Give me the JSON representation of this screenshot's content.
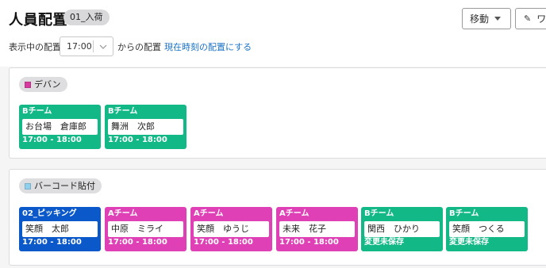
{
  "header": {
    "title": "人員配置",
    "badge": "01_入荷",
    "move_button": "移動",
    "edit_button": "ワ"
  },
  "filter": {
    "label": "表示中の配置:",
    "time": "17:00",
    "suffix": "からの配置",
    "current_link": "現在時刻の配置にする"
  },
  "sections": [
    {
      "name": "デバン",
      "color": "#d63a9f",
      "cards": [
        {
          "team": "Bチーム",
          "name": "お台場　倉庫郎",
          "time": "17:00 - 18:00",
          "color": "#12b886"
        },
        {
          "team": "Bチーム",
          "name": "舞洲　次郎",
          "time": "17:00 - 18:00",
          "color": "#12b886"
        }
      ]
    },
    {
      "name": "バーコード貼付",
      "color": "#8fd0ef",
      "cards": [
        {
          "team": "02_ピッキング",
          "name": "笑顔　太郎",
          "time": "17:00 - 18:00",
          "color": "#0a58ca"
        },
        {
          "team": "Aチーム",
          "name": "中原　ミライ",
          "time": "17:00 - 18:00",
          "color": "#e040b6"
        },
        {
          "team": "Aチーム",
          "name": "笑顔　ゆうじ",
          "time": "17:00 - 18:00",
          "color": "#e040b6"
        },
        {
          "team": "Aチーム",
          "name": "未来　花子",
          "time": "17:00 - 18:00",
          "color": "#e040b6"
        },
        {
          "team": "Bチーム",
          "name": "関西　ひかり",
          "time": "変更未保存",
          "color": "#12b886"
        },
        {
          "team": "Bチーム",
          "name": "笑顔　つくる",
          "time": "変更未保存",
          "color": "#12b886"
        }
      ]
    }
  ]
}
